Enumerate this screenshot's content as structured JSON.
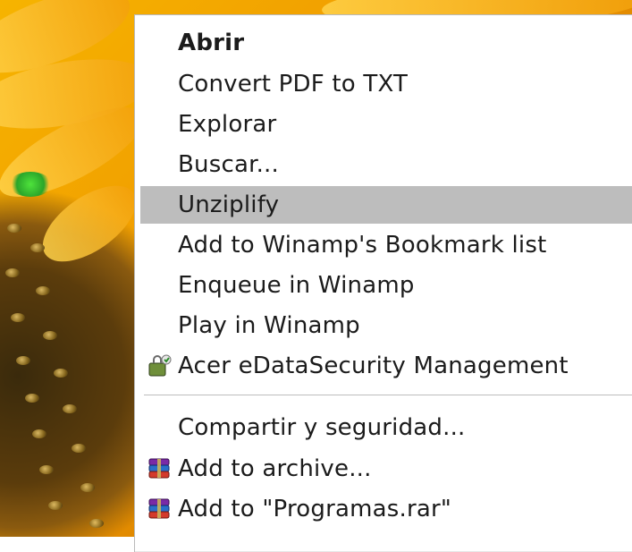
{
  "context_menu": {
    "items": [
      {
        "label": "Abrir"
      },
      {
        "label": "Convert PDF to TXT"
      },
      {
        "label": "Explorar"
      },
      {
        "label": "Buscar..."
      },
      {
        "label": "Unziplify"
      },
      {
        "label": "Add to Winamp's Bookmark list"
      },
      {
        "label": "Enqueue in Winamp"
      },
      {
        "label": "Play in Winamp"
      },
      {
        "label": "Acer eDataSecurity Management",
        "icon": "acer-edatasecurity-icon"
      },
      {
        "label": "Compartir y seguridad..."
      },
      {
        "label": "Add to archive...",
        "icon": "winrar-icon"
      },
      {
        "label": "Add to \"Programas.rar\"",
        "icon": "winrar-icon"
      }
    ],
    "highlighted_item": "Unziplify",
    "default_item": "Abrir",
    "colors": {
      "highlight": "#bdbdbd",
      "menu_background": "#ffffff",
      "text": "#1b1b1b"
    }
  },
  "wallpaper": {
    "subject": "sunflower"
  }
}
